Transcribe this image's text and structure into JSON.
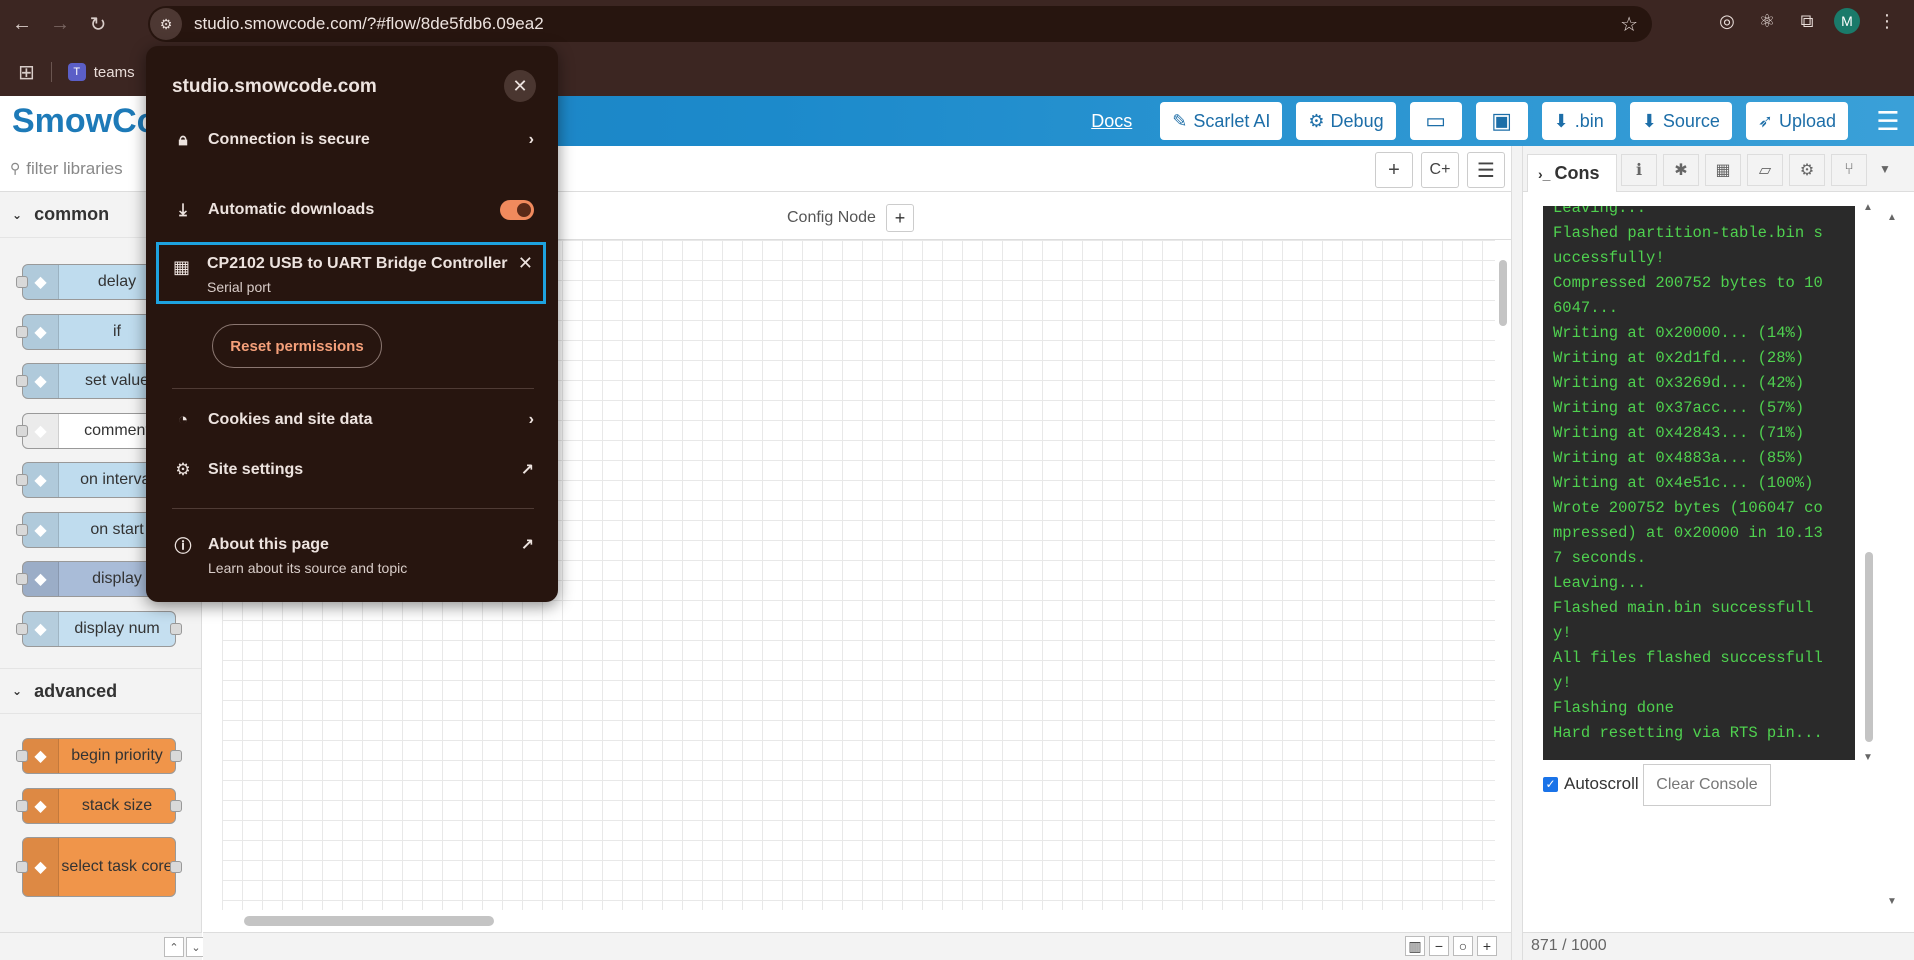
{
  "browser": {
    "url": "studio.smowcode.com/?#flow/8de5fdb6.09ea2",
    "bookmark_teams": "teams",
    "avatar_letter": "M"
  },
  "site_info": {
    "domain": "studio.smowcode.com",
    "connection": "Connection is secure",
    "auto_downloads": "Automatic downloads",
    "auto_downloads_on": true,
    "device_name": "CP2102 USB to UART Bridge Controller",
    "device_type": "Serial port",
    "reset_label": "Reset permissions",
    "cookies": "Cookies and site data",
    "site_settings": "Site settings",
    "about_title": "About this page",
    "about_sub": "Learn about its source and topic"
  },
  "header": {
    "logo": "SmowCode",
    "docs": "Docs",
    "scarlet": "Scarlet AI",
    "debug": "Debug",
    "bin": ".bin",
    "source": "Source",
    "upload": "Upload"
  },
  "palette": {
    "filter_placeholder": "filter libraries",
    "cat_common": "common",
    "cat_advanced": "advanced",
    "common_nodes": [
      {
        "label": "delay",
        "color": "#bfdcee"
      },
      {
        "label": "if",
        "color": "#bfdcee"
      },
      {
        "label": "set value",
        "color": "#bfdcee"
      },
      {
        "label": "comment",
        "color": "#ffffff"
      },
      {
        "label": "on interval",
        "color": "#bfdcee"
      },
      {
        "label": "on start",
        "color": "#bfdcee"
      },
      {
        "label": "display",
        "color": "#a9bcd8"
      },
      {
        "label": "display num",
        "color": "#c5dff0"
      }
    ],
    "advanced_nodes": [
      {
        "label": "begin priority",
        "color": "#f0954a"
      },
      {
        "label": "stack size",
        "color": "#f0954a"
      },
      {
        "label": "select task core",
        "color": "#f0954a"
      }
    ]
  },
  "workspace": {
    "config_node": "Config Node"
  },
  "sidebar": {
    "tab_label": "Cons",
    "console_lines": [
      "Leaving...",
      "Flashed partition-table.bin s",
      "uccessfully!",
      "Compressed 200752 bytes to 10",
      "6047...",
      "Writing at 0x20000... (14%)",
      "Writing at 0x2d1fd... (28%)",
      "Writing at 0x3269d... (42%)",
      "Writing at 0x37acc... (57%)",
      "Writing at 0x42843... (71%)",
      "Writing at 0x4883a... (85%)",
      "Writing at 0x4e51c... (100%)",
      "Wrote 200752 bytes (106047 co",
      "mpressed) at 0x20000 in 10.13",
      "7 seconds.",
      "Leaving...",
      "Flashed main.bin successfull",
      "y!",
      "All files flashed successfull",
      "y!",
      "Flashing done",
      "Hard resetting via RTS pin..."
    ],
    "autoscroll": "Autoscroll",
    "autoscroll_checked": true,
    "clear_console": "Clear Console",
    "footer_count": "871 / 1000"
  }
}
